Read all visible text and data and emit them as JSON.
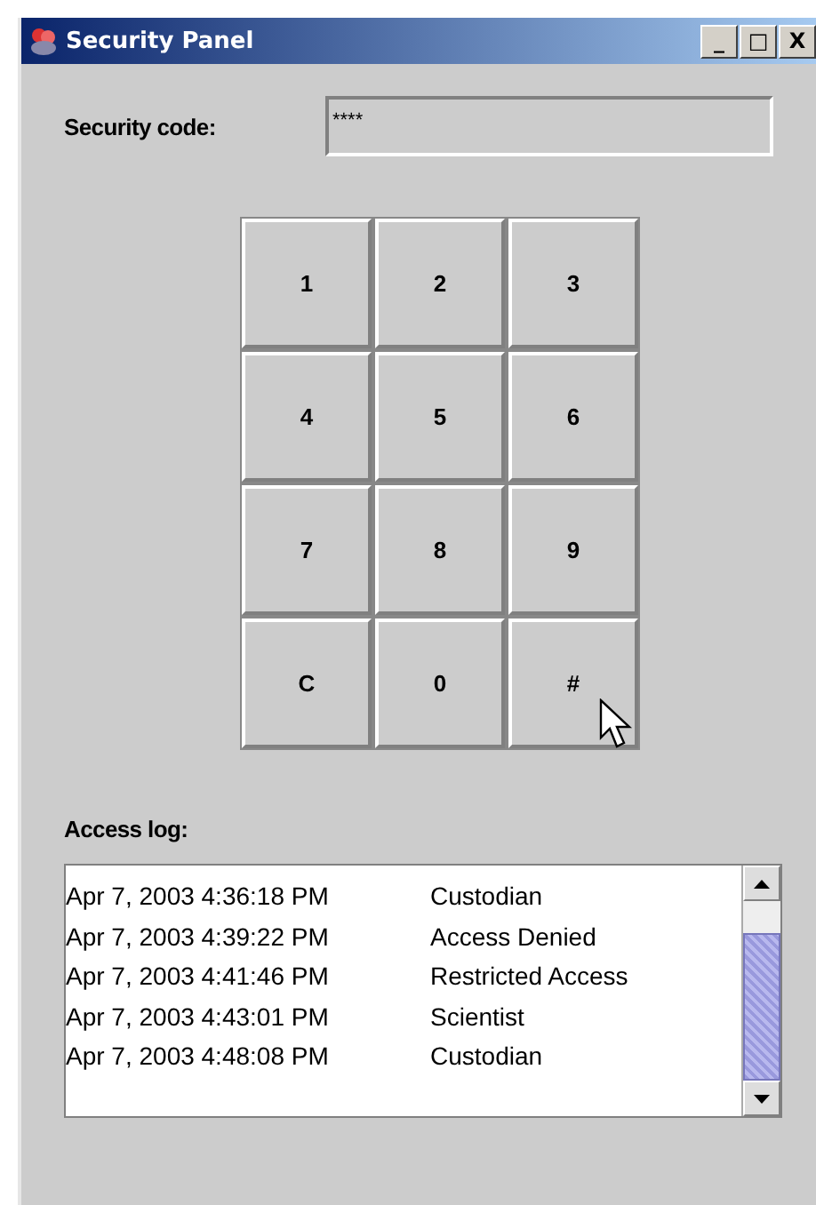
{
  "window": {
    "title": "Security Panel",
    "controls": [
      "_",
      "□",
      "X"
    ]
  },
  "security_code": {
    "label": "Security code:",
    "value": "****"
  },
  "keypad": [
    "1",
    "2",
    "3",
    "4",
    "5",
    "6",
    "7",
    "8",
    "9",
    "C",
    "0",
    "#"
  ],
  "access_log": {
    "label": "Access log:",
    "entries": [
      {
        "time": "Apr 7, 2003 4:36:18 PM",
        "event": "Custodian"
      },
      {
        "time": "Apr 7, 2003 4:39:22 PM",
        "event": "Access Denied"
      },
      {
        "time": "Apr 7, 2003 4:41:46 PM",
        "event": "Restricted Access"
      },
      {
        "time": "Apr 7, 2003 4:43:01 PM",
        "event": "Scientist"
      },
      {
        "time": "Apr 7, 2003 4:48:08 PM",
        "event": "Custodian"
      }
    ]
  }
}
